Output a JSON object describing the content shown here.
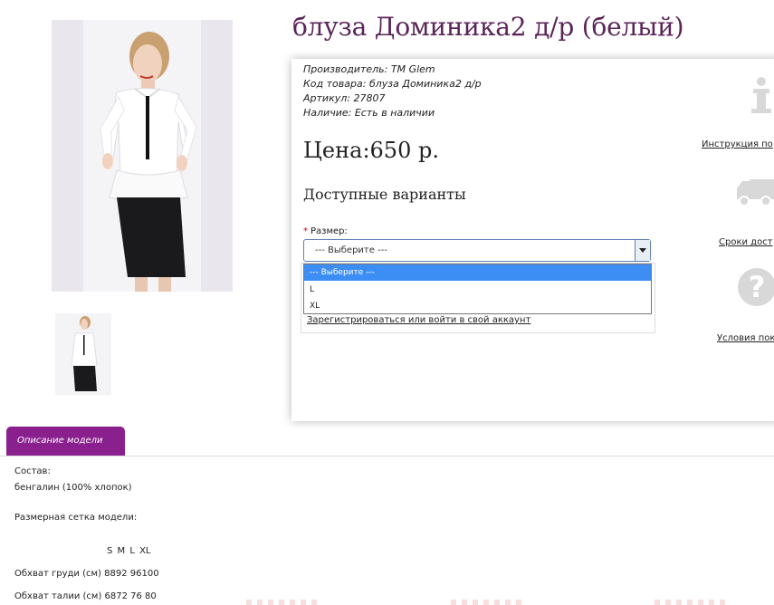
{
  "product": {
    "title": "блуза Доминика2 д/р (белый)",
    "manufacturer_label": "Производитель:",
    "manufacturer_value": "TM Glem",
    "code_label": "Код товара:",
    "code_value": "блуза Доминика2 д/р",
    "sku_label": "Артикул:",
    "sku_value": "27807",
    "stock_label": "Наличие:",
    "stock_value": "Есть в наличии",
    "price": "Цена:650 р.",
    "options_title": "Доступные варианты",
    "size_label": "Размер:",
    "size_selected": "--- Выберите ---",
    "size_options": [
      "--- Выберите ---",
      "L",
      "XL"
    ],
    "login_link": "Зарегистрироваться или войти в свой аккаунт"
  },
  "side": {
    "instruction_link": "Инструкция по",
    "delivery_link": "Сроки дост",
    "conditions_link": "Условия пок"
  },
  "description": {
    "tab_label": "Описание модели",
    "composition_label": "Состав:",
    "composition_value": "бенгалин (100% хлопок)",
    "size_chart_title": "Размерная сетка модели:",
    "size_header": "S  M  L  XL",
    "chest_row": "Обхват груди (см) 8892 96100",
    "waist_row": "Обхват талии (см) 6872 76  80"
  },
  "colors": {
    "title": "#5a2458",
    "tab": "#8a1f8e",
    "select_border": "#5c7fb6",
    "option_highlight": "#3d8ef4"
  },
  "icons": [
    "info-icon",
    "truck-icon",
    "question-icon",
    "dropdown-arrow-icon"
  ]
}
